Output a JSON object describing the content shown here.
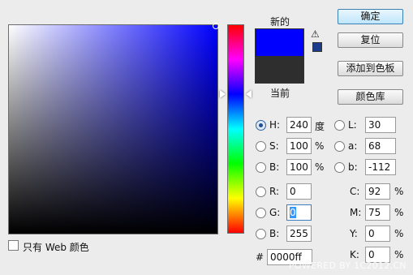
{
  "colors": {
    "new": "#0000ff",
    "current": "#2e2e2e",
    "websafe": "#1a3a8a"
  },
  "swatch": {
    "new_label": "新的",
    "current_label": "当前"
  },
  "icons": {
    "warning": "⚠"
  },
  "buttons": {
    "ok": "确定",
    "reset": "复位",
    "add_swatch": "添加到色板",
    "color_library": "颜色库"
  },
  "hsb": {
    "h": {
      "label": "H:",
      "value": "240",
      "unit": "度"
    },
    "s": {
      "label": "S:",
      "value": "100",
      "unit": "%"
    },
    "b": {
      "label": "B:",
      "value": "100",
      "unit": "%"
    }
  },
  "lab": {
    "l": {
      "label": "L:",
      "value": "30"
    },
    "a": {
      "label": "a:",
      "value": "68"
    },
    "b": {
      "label": "b:",
      "value": "-112"
    }
  },
  "rgb": {
    "r": {
      "label": "R:",
      "value": "0"
    },
    "g": {
      "label": "G:",
      "value": "0"
    },
    "b": {
      "label": "B:",
      "value": "255"
    }
  },
  "cmyk": {
    "c": {
      "label": "C:",
      "value": "92",
      "unit": "%"
    },
    "m": {
      "label": "M:",
      "value": "75",
      "unit": "%"
    },
    "y": {
      "label": "Y:",
      "value": "0",
      "unit": "%"
    },
    "k": {
      "label": "K:",
      "value": "0",
      "unit": "%"
    }
  },
  "hex": {
    "prefix": "#",
    "value": "0000ff"
  },
  "web_only": {
    "label": "只有 Web 颜色",
    "checked": false
  },
  "watermark": "POWERED BY 1C2012.CN"
}
